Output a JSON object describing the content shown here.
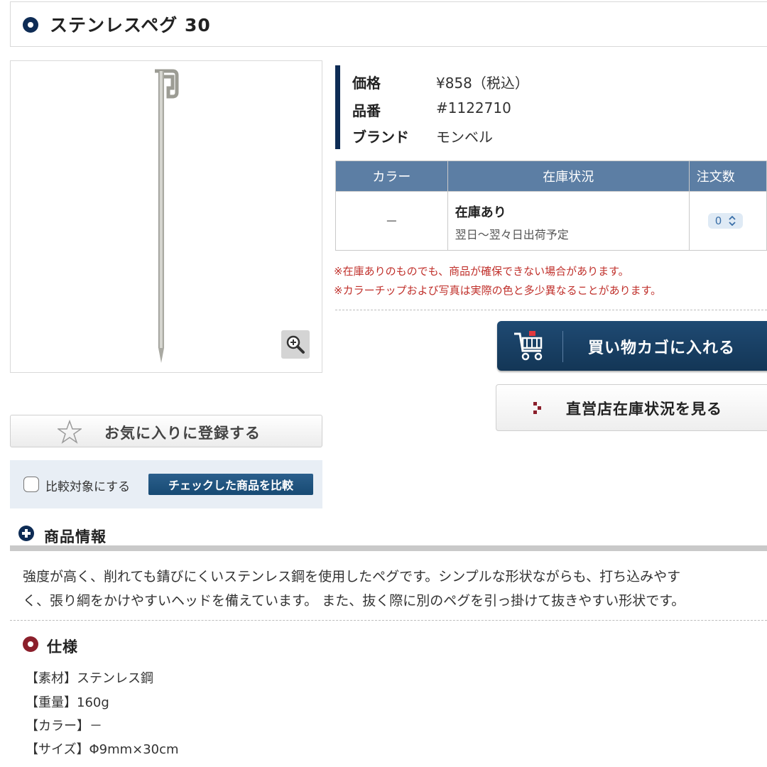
{
  "product": {
    "title": "ステンレスペグ 30",
    "price_label": "価格",
    "price_value": "¥858（税込）",
    "code_label": "品番",
    "code_value": "#1122710",
    "brand_label": "ブランド",
    "brand_value": "モンベル"
  },
  "stock_table": {
    "headers": [
      "カラー",
      "在庫状況",
      "注文数"
    ],
    "row": {
      "color": "－",
      "status": "在庫あり",
      "shipping": "翌日～翌々日出荷予定",
      "qty": "0"
    }
  },
  "notes": [
    "※在庫ありのものでも、商品が確保できない場合があります。",
    "※カラーチップおよび写真は実際の色と多少異なることがあります。"
  ],
  "buttons": {
    "cart": "買い物カゴに入れる",
    "store": "直営店在庫状況を見る",
    "favorite": "お気に入りに登録する",
    "compare_checkbox": "比較対象にする",
    "compare_button": "チェックした商品を比較"
  },
  "info_section": {
    "title": "商品情報",
    "lines": [
      "強度が高く、削れても錆びにくいステンレス鋼を使用したペグです。シンプルな形状ながらも、打ち込みやす",
      "く、張り綱をかけやすいヘッドを備えています。 また、抜く際に別のペグを引っ掛けて抜きやすい形状です。"
    ]
  },
  "spec_section": {
    "title": "仕様",
    "items": [
      "【素材】ステンレス鋼",
      "【重量】160g",
      "【カラー】－",
      "【サイズ】Φ9mm×30cm"
    ]
  },
  "colors": {
    "navy": "#0e2c55",
    "table_header": "#5c7ea4",
    "note_red": "#c0302b",
    "spec_icon": "#8b1f2b"
  },
  "icons": {
    "title": "circle-bullet-icon",
    "zoom": "magnifier-plus-icon",
    "cart": "shopping-cart-icon",
    "store": "red-arrow-icon",
    "favorite": "star-outline-icon",
    "info": "plus-circle-icon",
    "spec": "ring-bullet-icon",
    "qty": "up-down-chevron-icon"
  }
}
